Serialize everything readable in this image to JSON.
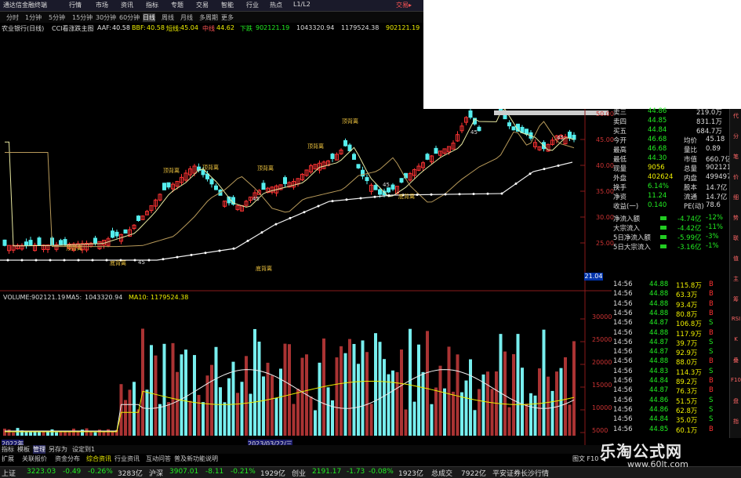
{
  "title_bar": {
    "app_title": "通达信金融终端",
    "menus": [
      "行情",
      "市场",
      "资讯",
      "指标",
      "专题",
      "交易",
      "智能",
      "行业",
      "热点",
      "L1/L2"
    ],
    "right_item": "交易▸"
  },
  "toolbar": {
    "periods": [
      "分时",
      "1分钟",
      "5分钟",
      "15分钟",
      "30分钟",
      "60分钟",
      "日线",
      "周线",
      "月线",
      "多周期",
      "更多"
    ]
  },
  "chart_info": {
    "stock": "农业银行(日线)",
    "indicator_name": "CCI看涨跌主图",
    "aaf_label": "AAF:",
    "aaf_value": "40.58",
    "bbf_label": "BBF:",
    "bbf_value": "40.58",
    "ld_label": "短线:",
    "ld_value": "45.04",
    "mid_label": "中线",
    "mid_value": "44.62",
    "low_label": "下跌",
    "v1": "902121.19",
    "v2": "1043320.94",
    "v3": "1179524.38",
    "v4": "902121.19"
  },
  "price_axis": [
    "50.00",
    "45.00",
    "40.00",
    "35.00",
    "30.00",
    "25.00"
  ],
  "price_current_tag": "21.04",
  "volume_info": {
    "label": "VOLUME:",
    "volume": "902121.19",
    "ma5_label": "MA5:",
    "ma5": "1043320.94",
    "ma10_label": "MA10:",
    "ma10": "1179524.38"
  },
  "volume_axis": [
    "30000",
    "25000",
    "20000",
    "15000",
    "10000",
    "5000"
  ],
  "annotations": [
    "顶背离",
    "顶背离",
    "顶背离",
    "顶背离",
    "顶背离",
    "底背离",
    "底背离",
    "底背离",
    "顶背离",
    "45",
    "45",
    "45",
    "45",
    "45"
  ],
  "date_labels": [
    "2022年",
    "2023/03/22/三"
  ],
  "quote_panel": {
    "rows": [
      {
        "k": "卖三",
        "v": "44.86",
        "v2": "219.0万"
      },
      {
        "k": "卖四",
        "v": "44.85",
        "v2": "831.1万"
      },
      {
        "k": "买五",
        "v": "44.84",
        "v2": "684.7万"
      },
      {
        "k": "今开",
        "v": "46.68",
        "k2": "均价",
        "v3": "45.18"
      },
      {
        "k": "最高",
        "v": "46.68",
        "k2": "量比",
        "v3": "0.89"
      },
      {
        "k": "最低",
        "v": "44.30",
        "k2": "市值",
        "v3": "660.7亿"
      },
      {
        "k": "现量",
        "v": "9056",
        "k2": "总量",
        "v3": "902121"
      },
      {
        "k": "外盘",
        "v": "402624",
        "k2": "内盘",
        "v3": "499497"
      },
      {
        "k": "换手",
        "v": "6.14%",
        "k2": "股本",
        "v3": "14.7亿"
      },
      {
        "k": "净资",
        "v": "11.24",
        "k2": "流通",
        "v3": "14.7亿"
      },
      {
        "k": "收益(一)",
        "v": "0.140",
        "k2": "PE(动)",
        "v3": "78.6"
      },
      {
        "k": "净流入额",
        "v": "-4.74亿",
        "v3": "-12%"
      },
      {
        "k": "大宗流入",
        "v": "-4.42亿",
        "v3": "-11%"
      },
      {
        "k": "5日净流入额",
        "v": "-5.99亿",
        "v3": "-3%"
      },
      {
        "k": "5日大宗流入",
        "v": "-3.16亿",
        "v3": "-1%"
      }
    ]
  },
  "ticks": [
    {
      "t": "14:56",
      "p": "44.88",
      "v": "115.8万",
      "d": "B"
    },
    {
      "t": "14:56",
      "p": "44.88",
      "v": "63.3万",
      "d": "B"
    },
    {
      "t": "14:56",
      "p": "44.88",
      "v": "93.4万",
      "d": "B"
    },
    {
      "t": "14:56",
      "p": "44.88",
      "v": "80.8万",
      "d": "B"
    },
    {
      "t": "14:56",
      "p": "44.87",
      "v": "106.8万",
      "d": "S"
    },
    {
      "t": "14:56",
      "p": "44.88",
      "v": "117.9万",
      "d": "B"
    },
    {
      "t": "14:56",
      "p": "44.87",
      "v": "39.7万",
      "d": "S"
    },
    {
      "t": "14:56",
      "p": "44.87",
      "v": "92.9万",
      "d": "S"
    },
    {
      "t": "14:56",
      "p": "44.88",
      "v": "88.0万",
      "d": "B"
    },
    {
      "t": "14:56",
      "p": "44.83",
      "v": "114.3万",
      "d": "S"
    },
    {
      "t": "14:56",
      "p": "44.84",
      "v": "89.2万",
      "d": "B"
    },
    {
      "t": "14:56",
      "p": "44.87",
      "v": "76.3万",
      "d": "B"
    },
    {
      "t": "14:56",
      "p": "44.86",
      "v": "51.5万",
      "d": "S"
    },
    {
      "t": "14:56",
      "p": "44.86",
      "v": "62.8万",
      "d": "S"
    },
    {
      "t": "14:56",
      "p": "44.84",
      "v": "35.0万",
      "d": "S"
    },
    {
      "t": "14:56",
      "p": "44.85",
      "v": "60.1万",
      "d": "B"
    }
  ],
  "side_tabs": [
    "代",
    "分",
    "笔",
    "价",
    "细",
    "势",
    "联",
    "值",
    "主",
    "筹",
    "RSI",
    "K",
    "叠",
    "F10",
    "盘",
    "指"
  ],
  "bottom_tabs": [
    "指标",
    "模板",
    "管理",
    "另存为",
    "设定到1"
  ],
  "bottom_links": [
    "扩展",
    "关联报价",
    "资金分布",
    "综合资讯",
    "行业资讯",
    "互动问答",
    "普及新功能说明"
  ],
  "bottom_right": "图文 F10 ◀",
  "status_bar": [
    {
      "label": "上证",
      "value": "3223.03",
      "chg": "-0.49",
      "pct": "-0.26%",
      "amt": "3283亿"
    },
    {
      "label": "沪深",
      "value": "3907.01",
      "chg": "-8.11",
      "pct": "-0.21%",
      "amt": "1929亿"
    },
    {
      "label": "创业",
      "value": "2191.17",
      "chg": "-1.73",
      "pct": "-0.08%",
      "amt": "1923亿"
    },
    {
      "label": "总成交",
      "value": "7922亿",
      "chg": "",
      "pct": "",
      "amt": ""
    }
  ],
  "status_tail": "平安证券长沙行情",
  "watermark": {
    "line1": "乐淘公式网",
    "line2": "www.60lt.com"
  },
  "colors": {
    "up": "#f33",
    "down": "#5ee",
    "ma_short": "#e8e8a0",
    "ma_long": "#b89a5a",
    "annotation": "#f3c740",
    "background": "#000000"
  }
}
